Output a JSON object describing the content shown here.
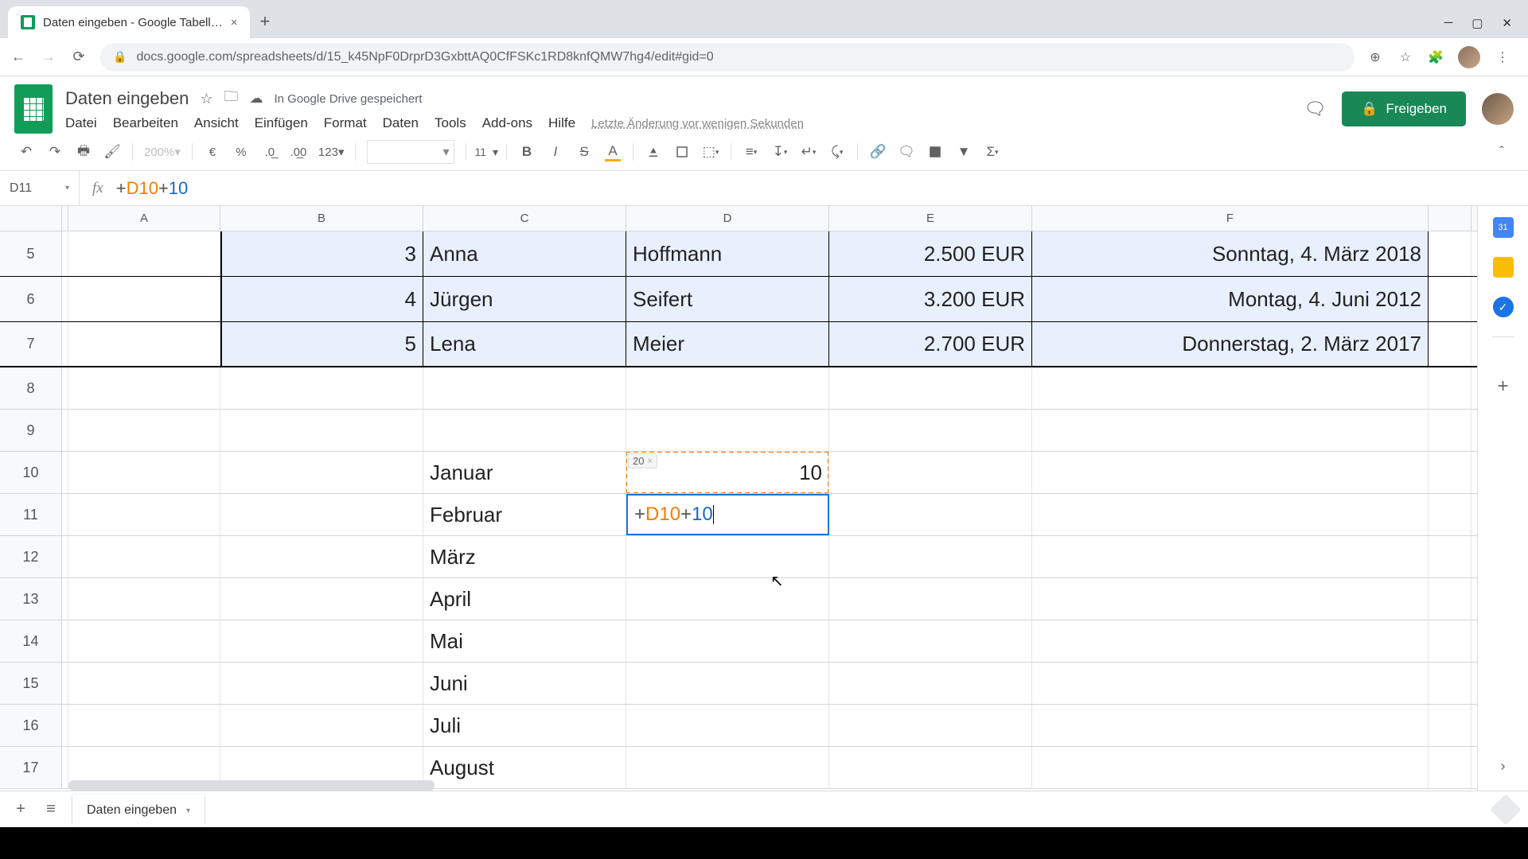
{
  "browser": {
    "tab_title": "Daten eingeben - Google Tabell…",
    "url": "docs.google.com/spreadsheets/d/15_k45NpF0DrprD3GxbttAQ0CfFSKc1RD8knfQMW7hg4/edit#gid=0"
  },
  "doc": {
    "title": "Daten eingeben",
    "saved_msg": "In Google Drive gespeichert",
    "menus": [
      "Datei",
      "Bearbeiten",
      "Ansicht",
      "Einfügen",
      "Format",
      "Daten",
      "Tools",
      "Add-ons",
      "Hilfe"
    ],
    "last_edit": "Letzte Änderung vor wenigen Sekunden",
    "share_label": "Freigeben"
  },
  "toolbar": {
    "zoom": "200%",
    "currency": "€",
    "percent": "%",
    "dec_less": ".0",
    "dec_more": ".00",
    "format_label": "123",
    "font_size": "11",
    "dropdown_glyph": "▾"
  },
  "formula": {
    "name_box": "D11",
    "plus1": "+",
    "ref": "D10",
    "plus2": "+",
    "lit": "10"
  },
  "columns": [
    "A",
    "B",
    "C",
    "D",
    "E",
    "F"
  ],
  "row_labels": [
    "5",
    "6",
    "7",
    "8",
    "9",
    "10",
    "11",
    "12",
    "13",
    "14",
    "15",
    "16",
    "17"
  ],
  "cells": {
    "B5": "3",
    "C5": "Anna",
    "D5": "Hoffmann",
    "E5": "2.500 EUR",
    "F5": "Sonntag, 4. März 2018",
    "B6": "4",
    "C6": "Jürgen",
    "D6": "Seifert",
    "E6": "3.200 EUR",
    "F6": "Montag, 4. Juni 2012",
    "B7": "5",
    "C7": "Lena",
    "D7": "Meier",
    "E7": "2.700 EUR",
    "F7": "Donnerstag, 2. März 2017",
    "C10": "Januar",
    "D10": "10",
    "C11": "Februar",
    "C12": "März",
    "C13": "April",
    "C14": "Mai",
    "C15": "Juni",
    "C16": "Juli",
    "C17": "August"
  },
  "edit": {
    "preview_value": "20",
    "plus1": "+",
    "ref": "D10",
    "plus2": "+",
    "lit": "10"
  },
  "sheets_bar": {
    "tab_name": "Daten eingeben"
  }
}
